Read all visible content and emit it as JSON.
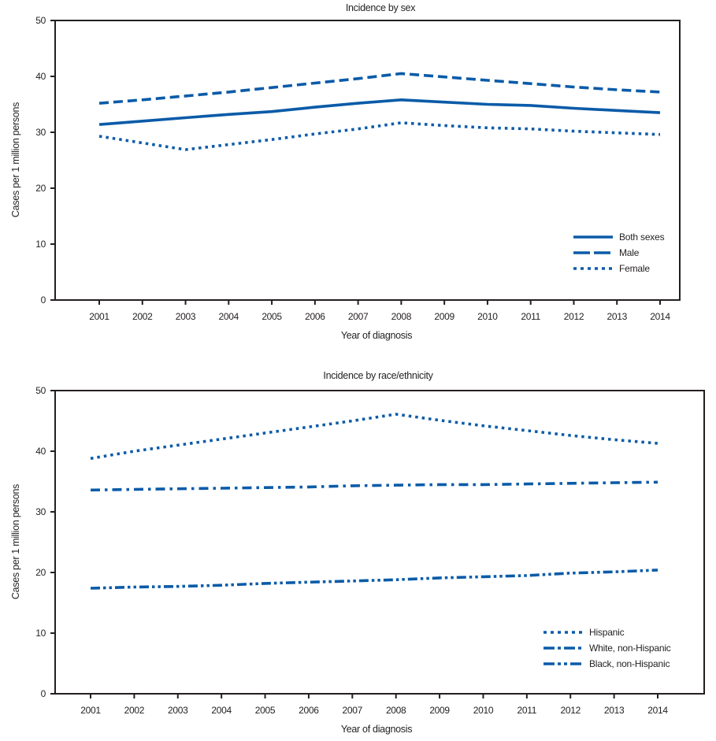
{
  "chart_data": [
    {
      "type": "line",
      "title": "Incidence by sex",
      "xlabel": "Year of diagnosis",
      "ylabel": "Cases per 1 million persons",
      "ylim": [
        0,
        50
      ],
      "yticks": [
        "0",
        "10",
        "20",
        "30",
        "40",
        "50"
      ],
      "x": [
        "2001",
        "2002",
        "2003",
        "2004",
        "2005",
        "2006",
        "2007",
        "2008",
        "2009",
        "2010",
        "2011",
        "2012",
        "2013",
        "2014"
      ],
      "grid": false,
      "legend_position": "bottom-right",
      "series": [
        {
          "name": "Both sexes",
          "style": "solid",
          "color": "#0a5ba8",
          "values": [
            31.4,
            32.0,
            32.6,
            33.2,
            33.7,
            34.5,
            35.2,
            35.8,
            35.4,
            35.0,
            34.8,
            34.3,
            33.9,
            33.5
          ]
        },
        {
          "name": "Male",
          "style": "dashed",
          "color": "#0a5ba8",
          "values": [
            35.2,
            35.8,
            36.5,
            37.2,
            38.0,
            38.8,
            39.6,
            40.5,
            39.9,
            39.3,
            38.7,
            38.1,
            37.6,
            37.2
          ]
        },
        {
          "name": "Female",
          "style": "dotted",
          "color": "#0a5ba8",
          "values": [
            29.3,
            28.1,
            26.9,
            27.8,
            28.7,
            29.7,
            30.6,
            31.7,
            31.2,
            30.8,
            30.6,
            30.2,
            29.9,
            29.6
          ]
        }
      ]
    },
    {
      "type": "line",
      "title": "Incidence by race/ethnicity",
      "xlabel": "Year of diagnosis",
      "ylabel": "Cases per 1 million persons",
      "ylim": [
        0,
        50
      ],
      "yticks": [
        "0",
        "10",
        "20",
        "30",
        "40",
        "50"
      ],
      "x": [
        "2001",
        "2002",
        "2003",
        "2004",
        "2005",
        "2006",
        "2007",
        "2008",
        "2009",
        "2010",
        "2011",
        "2012",
        "2013",
        "2014"
      ],
      "grid": false,
      "legend_position": "bottom-right",
      "series": [
        {
          "name": "Hispanic",
          "style": "dotted",
          "color": "#0a5ba8",
          "values": [
            38.8,
            40.0,
            41.0,
            42.0,
            43.0,
            44.0,
            45.0,
            46.1,
            45.1,
            44.2,
            43.4,
            42.6,
            41.9,
            41.3
          ]
        },
        {
          "name": "White, non-Hispanic",
          "style": "dash-dot",
          "color": "#0a5ba8",
          "values": [
            33.6,
            33.7,
            33.8,
            33.9,
            34.0,
            34.1,
            34.3,
            34.4,
            34.5,
            34.5,
            34.6,
            34.7,
            34.8,
            34.9
          ]
        },
        {
          "name": "Black, non-Hispanic",
          "style": "dash-dot-dot",
          "color": "#0a5ba8",
          "values": [
            17.4,
            17.6,
            17.7,
            17.9,
            18.2,
            18.4,
            18.6,
            18.8,
            19.1,
            19.3,
            19.5,
            19.9,
            20.1,
            20.4
          ]
        }
      ]
    }
  ]
}
